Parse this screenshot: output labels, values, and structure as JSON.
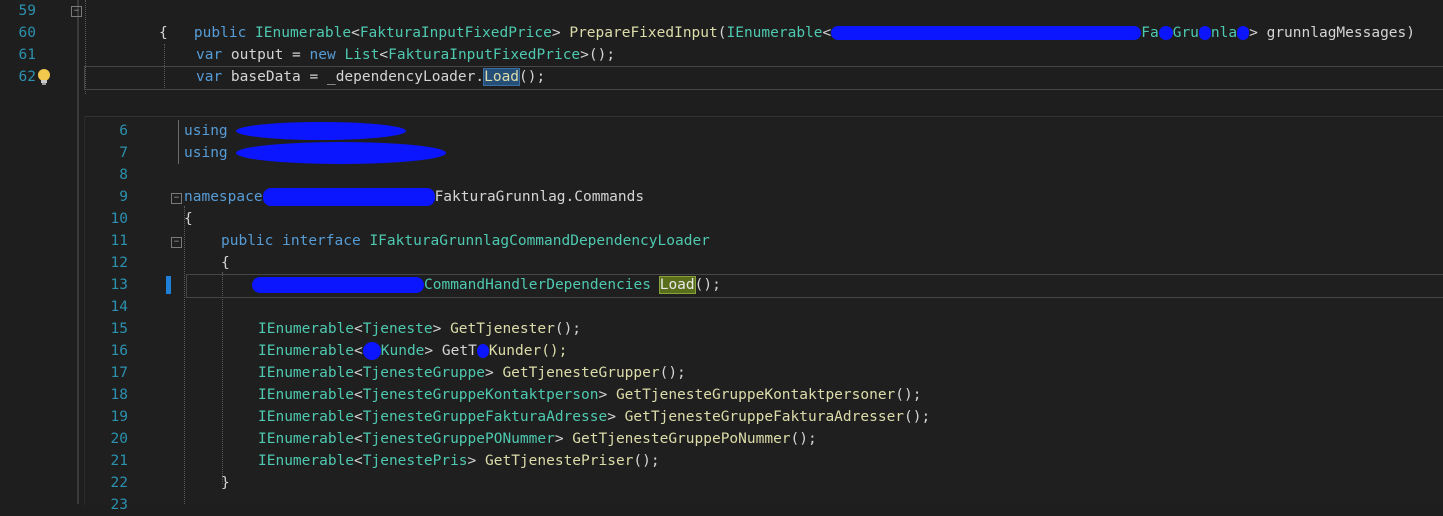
{
  "top_editor": {
    "lines": [
      {
        "num": "59",
        "text": "public IEnumerable<FakturaInputFixedPrice> PrepareFixedInput(IEnumerable<",
        "tail1": "Fa",
        "tail2": "Gru",
        "tail3": "nla",
        "tail4": "> grunnlagMessages)"
      },
      {
        "num": "60",
        "text": "{"
      },
      {
        "num": "61",
        "text": "var output = new List<FakturaInputFixedPrice>();"
      },
      {
        "num": "62",
        "text": "var baseData = _dependencyLoader.Load();"
      }
    ]
  },
  "peek_editor": {
    "lines": [
      {
        "num": "6",
        "text": "using"
      },
      {
        "num": "7",
        "text": "using"
      },
      {
        "num": "8",
        "text": ""
      },
      {
        "num": "9",
        "text": "namespace",
        "after": "FakturaGrunnlag.Commands"
      },
      {
        "num": "10",
        "text": "{"
      },
      {
        "num": "11",
        "text": "public interface IFakturaGrunnlagCommandDependencyLoader"
      },
      {
        "num": "12",
        "text": "{"
      },
      {
        "num": "13",
        "text": "CommandHandlerDependencies",
        "load": "Load",
        "after": "();"
      },
      {
        "num": "14",
        "text": ""
      },
      {
        "num": "15",
        "text": "IEnumerable<Tjeneste> GetTjenester();"
      },
      {
        "num": "16",
        "text": "IEnumerable<",
        "type": "Kunde",
        "mid": "> GetT",
        "after": "Kunder();"
      },
      {
        "num": "17",
        "text": "IEnumerable<TjenesteGruppe> GetTjenesteGrupper();"
      },
      {
        "num": "18",
        "text": "IEnumerable<TjenesteGruppeKontaktperson> GetTjenesteGruppeKontaktpersoner();"
      },
      {
        "num": "19",
        "text": "IEnumerable<TjenesteGruppeFakturaAdresse> GetTjenesteGruppeFakturaAdresser();"
      },
      {
        "num": "20",
        "text": "IEnumerable<TjenesteGruppePONummer> GetTjenesteGruppePoNummer();"
      },
      {
        "num": "21",
        "text": "IEnumerable<TjenestePris> GetTjenestePriser();"
      },
      {
        "num": "22",
        "text": "}"
      },
      {
        "num": "23",
        "text": ""
      }
    ]
  },
  "colors": {
    "background": "#1e1e1e",
    "keyword": "#569cd6",
    "type": "#4ec9b0",
    "function": "#dcdcaa",
    "line_number": "#2b91af",
    "redaction": "#0b16ff"
  },
  "icons": {
    "lightbulb": "lightbulb-icon",
    "collapse": "collapse-minus-icon"
  }
}
